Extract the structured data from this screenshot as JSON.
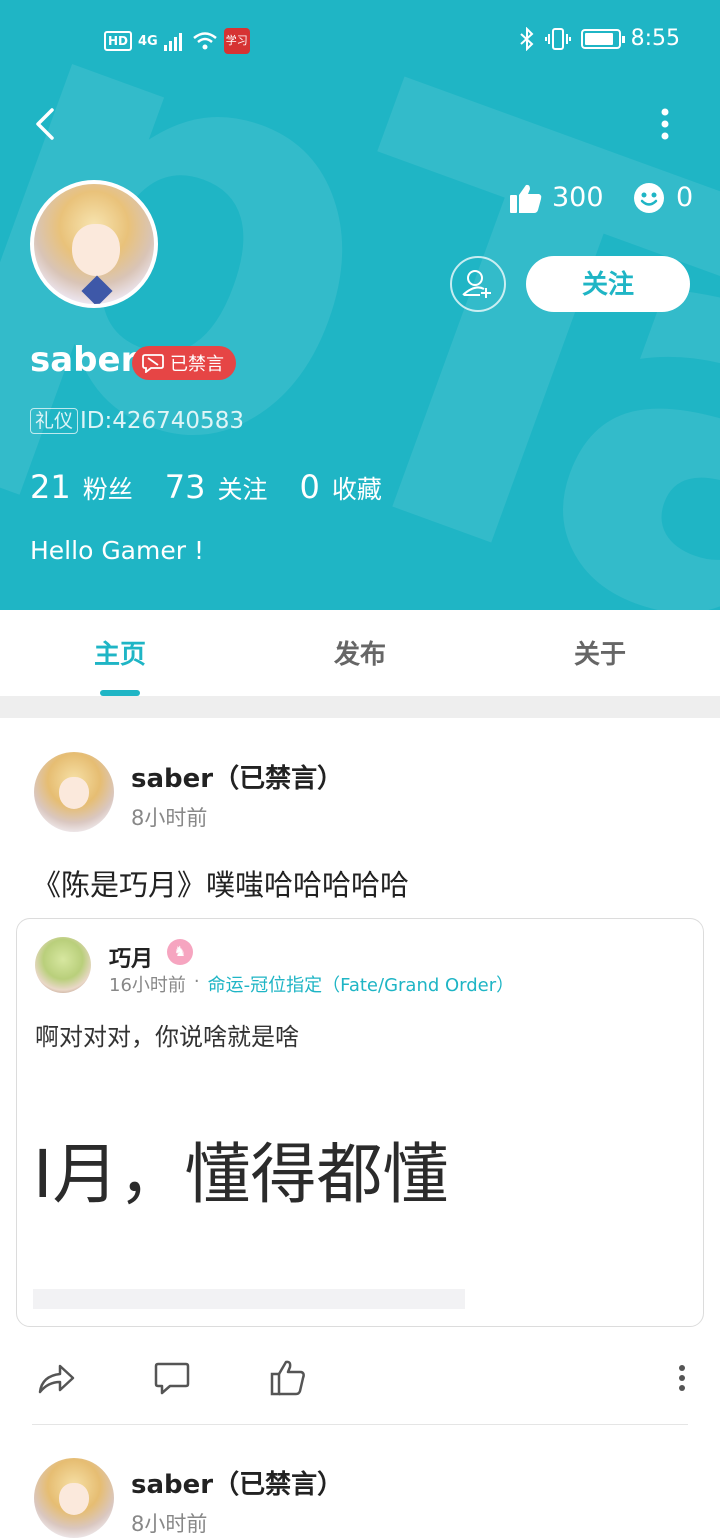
{
  "status_bar": {
    "hd": "HD",
    "signal": "4G",
    "app_badge": "学习",
    "time": "8:55"
  },
  "profile": {
    "watermark": "pTa",
    "likes": "300",
    "reactions": "0",
    "follow_label": "关注",
    "username": "saber",
    "banned_badge": "已禁言",
    "tag": "礼仪",
    "id_text": "ID:426740583",
    "stats": [
      {
        "num": "21",
        "label": "粉丝"
      },
      {
        "num": "73",
        "label": "关注"
      },
      {
        "num": "0",
        "label": "收藏"
      }
    ],
    "bio": "Hello Gamer !"
  },
  "tabs": [
    {
      "label": "主页"
    },
    {
      "label": "发布"
    },
    {
      "label": "关于"
    }
  ],
  "posts": [
    {
      "author": "saber（已禁言）",
      "time": "8小时前",
      "text": "《陈是巧月》噗嗤哈哈哈哈哈",
      "quote": {
        "author": "巧月",
        "level": "♞",
        "time": "16小时前",
        "separator": "·",
        "game": "命运-冠位指定（Fate/Grand Order）",
        "text": "啊对对对，你说啥就是啥",
        "image_text": "I月，懂得都懂"
      }
    },
    {
      "author": "saber（已禁言）",
      "time": "8小时前"
    }
  ],
  "colors": {
    "accent": "#1fb5c5",
    "ban": "#e64545"
  }
}
